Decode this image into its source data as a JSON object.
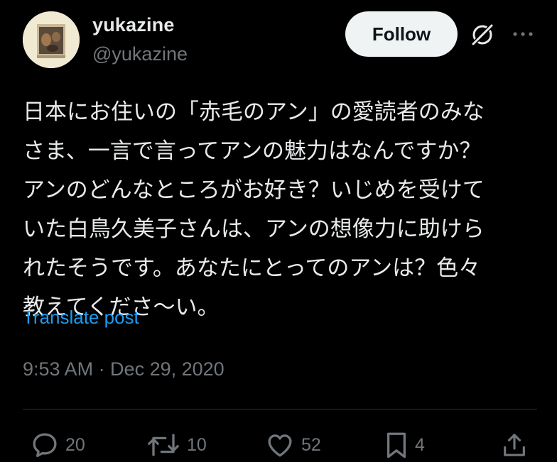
{
  "author": {
    "display_name": "yukazine",
    "handle": "@yukazine"
  },
  "follow_button_label": "Follow",
  "tweet": {
    "lines": [
      "日本にお住いの「赤毛のアン」の愛読者のみな",
      "さま、一言で言ってアンの魅力はなんですか？",
      "アンのどんなところがお好き？いじめを受けて",
      "いた白鳥久美子さんは、アンの想像力に助けら",
      "れたそうです。あなたにとってのアンは？色々",
      "教えてくださ〜い。"
    ],
    "translate_label": "Translate post",
    "timestamp": "9:53 AM · Dec 29, 2020"
  },
  "actions": {
    "replies": "20",
    "reposts": "10",
    "likes": "52",
    "bookmarks": "4"
  },
  "colors": {
    "background": "#000000",
    "text": "#e7e9ea",
    "muted": "#71767b",
    "link": "#1d9bf0",
    "button_bg": "#eff3f4"
  },
  "icons": {
    "avatar": "avatar-image",
    "grok": "grok-icon",
    "more": "more-icon",
    "reply": "reply-icon",
    "repost": "repost-icon",
    "like": "like-icon",
    "bookmark": "bookmark-icon",
    "share": "share-icon"
  }
}
